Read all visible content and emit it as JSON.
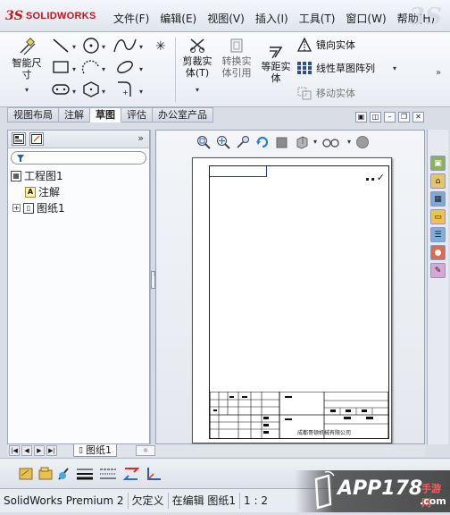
{
  "app": {
    "logo_mark": "3S",
    "logo_text": "SOLIDWORKS"
  },
  "menu": [
    "文件(F)",
    "编辑(E)",
    "视图(V)",
    "插入(I)",
    "工具(T)",
    "窗口(W)",
    "帮助(H)"
  ],
  "commands": {
    "smart_dim": {
      "line1": "智能尺",
      "line2": "寸"
    },
    "trim": {
      "line1": "剪裁实",
      "line2": "体(T)"
    },
    "convert": {
      "line1": "转换实",
      "line2": "体引用"
    },
    "offset": {
      "line1": "等距实",
      "line2": "体"
    },
    "mirror": "镜向实体",
    "linear_pattern": "线性草图阵列",
    "move": "移动实体"
  },
  "tabs": [
    "视图布局",
    "注解",
    "草图",
    "评估",
    "办公室产品"
  ],
  "active_tab_index": 2,
  "tree": {
    "root": "工程图1",
    "annotation": "注解",
    "sheet": "图纸1"
  },
  "sheet_tab": "图纸1",
  "title_block": {
    "company": "成都哥顿机械有限公司",
    "rough": "✓"
  },
  "status": {
    "product": "SolidWorks Premium 2",
    "state": "欠定义",
    "editing": "在编辑 图纸1",
    "scale": "1 : 2"
  },
  "watermark": {
    "brand": "APP178",
    "sub": "手游网",
    "domain": ".com"
  },
  "colors": {
    "accent": "#c0161c",
    "menu_bg": "#e6ebf2",
    "sheet_bg": "#ffffff"
  }
}
